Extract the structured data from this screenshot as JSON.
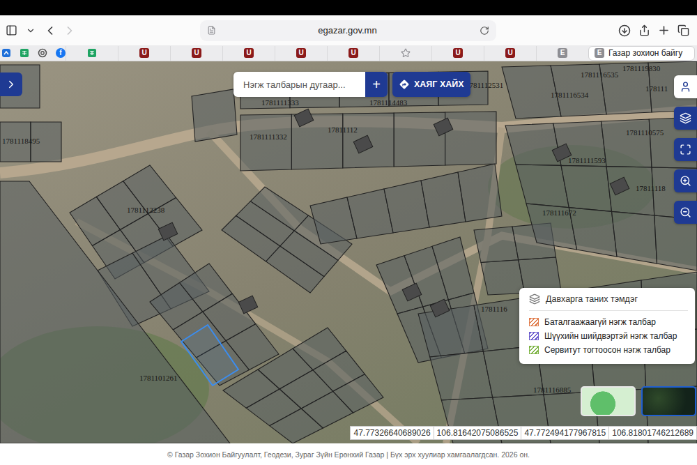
{
  "browser": {
    "url": "egazar.gov.mn",
    "nav": {
      "back_disabled": false,
      "forward_disabled": true
    },
    "pinned": [
      {
        "kind": "app",
        "color": "#1e6fd9"
      },
      {
        "kind": "sheets",
        "color": "#1fa463"
      },
      {
        "kind": "openai",
        "color": "#555555"
      },
      {
        "kind": "letter-round",
        "label": "f",
        "color": "#1877f2"
      }
    ],
    "tabs": [
      {
        "kind": "sheets",
        "color": "#1fa463",
        "selected": false
      },
      {
        "kind": "letter",
        "label": "U",
        "color": "#8b1a1a",
        "selected": false
      },
      {
        "kind": "letter",
        "label": "U",
        "color": "#8b1a1a",
        "selected": false
      },
      {
        "kind": "letter",
        "label": "U",
        "color": "#8b1a1a",
        "selected": false
      },
      {
        "kind": "letter",
        "label": "U",
        "color": "#8b1a1a",
        "selected": false
      },
      {
        "kind": "letter",
        "label": "U",
        "color": "#8b1a1a",
        "selected": false
      },
      {
        "kind": "star",
        "color": "#8e8e93",
        "selected": false
      },
      {
        "kind": "letter",
        "label": "U",
        "color": "#8b1a1a",
        "selected": false
      },
      {
        "kind": "letter",
        "label": "U",
        "color": "#8b1a1a",
        "selected": false
      },
      {
        "kind": "letter",
        "label": "E",
        "color": "#8e8e93",
        "selected": false
      },
      {
        "kind": "letter",
        "label": "E",
        "color": "#8e8e93",
        "title": "Газар зохион байгу",
        "selected": true
      }
    ]
  },
  "map": {
    "search": {
      "placeholder": "Нэгж талбарын дугаар...",
      "add_button": "+"
    },
    "address_button": "ХАЯГ ХАЙХ",
    "controls": [
      {
        "kind": "user"
      },
      {
        "kind": "layers"
      },
      {
        "kind": "expand"
      },
      {
        "kind": "zoom-in"
      },
      {
        "kind": "zoom-out"
      }
    ],
    "parcel_labels": [
      "1781116535",
      "1781119830",
      "1781114483",
      "1781111333",
      "1781112531",
      "1781116534",
      "178111",
      "1781111332",
      "17811112",
      "1781118495",
      "1781110575",
      "1781111593",
      "1781112238",
      "17811118",
      "178111672",
      "1781101261",
      "1781116",
      "1781116885"
    ],
    "highlighted_parcel": {
      "selected": true
    },
    "legend": {
      "title": "Давхарга таних тэмдэг",
      "items": [
        {
          "label": "Баталгаажаагүй нэгж талбар",
          "color": "#e07b4a"
        },
        {
          "label": "Шүүхийн шийдвэртэй нэгж талбар",
          "color": "#6a5acd"
        },
        {
          "label": "Сервитут тогтоосон нэгж талбар",
          "color": "#7cb342"
        }
      ]
    },
    "basemaps": [
      {
        "kind": "map",
        "selected": false
      },
      {
        "kind": "satellite",
        "selected": true
      }
    ],
    "coordinates": [
      "47.77326640689026",
      "106.81642075086525",
      "47.772494177967815",
      "106.81801746212689"
    ]
  },
  "footer": "© Газар Зохион Байгуулалт, Геодези, Зураг Зүйн Ерөнхий Газар | Бүх эрх хуулиар хамгаалагдсан. 2026 он."
}
